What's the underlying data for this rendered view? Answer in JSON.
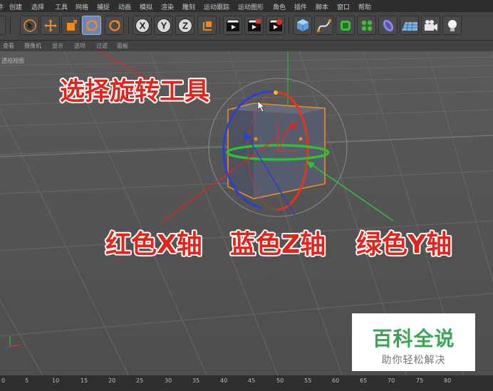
{
  "menu": {
    "items": [
      "创建",
      "选择",
      "工具",
      "网格",
      "捕捉",
      "动画",
      "模拟",
      "渲染",
      "雕刻",
      "运动跟踪",
      "运动图形",
      "角色",
      "插件",
      "脚本",
      "窗口",
      "帮助"
    ]
  },
  "toolbar": {
    "tools": [
      {
        "icon": "live-select-icon"
      },
      {
        "icon": "move-icon"
      },
      {
        "icon": "scale-icon"
      },
      {
        "icon": "rotate-icon",
        "active": true
      },
      {
        "icon": "recent-tool-icon"
      },
      {
        "icon": "x-axis-lock-icon",
        "label": "X"
      },
      {
        "icon": "y-axis-lock-icon",
        "label": "Y"
      },
      {
        "icon": "z-axis-lock-icon",
        "label": "Z"
      },
      {
        "icon": "coordinate-system-icon"
      },
      {
        "icon": "render-view-icon"
      },
      {
        "icon": "render-picture-viewer-icon"
      },
      {
        "icon": "render-settings-icon"
      },
      {
        "icon": "cube-icon"
      },
      {
        "icon": "spline-pen-icon"
      },
      {
        "icon": "subdivision-surface-icon"
      },
      {
        "icon": "cloner-icon"
      },
      {
        "icon": "deformer-icon"
      },
      {
        "icon": "floor-icon"
      },
      {
        "icon": "camera-icon"
      },
      {
        "icon": "light-icon"
      }
    ]
  },
  "view_menu": {
    "items": [
      "查看",
      "摄像机",
      "显示",
      "选项",
      "过滤",
      "面板"
    ]
  },
  "viewport": {
    "label": "透视视图",
    "colors": {
      "x_axis": "#e8321e",
      "y_axis": "#2ec22e",
      "z_axis": "#2a3fd6",
      "cube": "#555a68",
      "selection": "#f08a20"
    }
  },
  "annotations": {
    "rotate_tool": "选择旋转工具",
    "x_axis": "红色X轴",
    "z_axis": "蓝色Z轴",
    "y_axis": "绿色Y轴",
    "color": "#e3241a"
  },
  "watermark": {
    "title": "百科全说",
    "subtitle": "助你轻松解决"
  },
  "timeline": {
    "ticks": [
      "0",
      "5",
      "10",
      "15",
      "20",
      "25",
      "30",
      "35",
      "40",
      "45",
      "50",
      "55",
      "60",
      "65",
      "70",
      "75",
      "80"
    ]
  }
}
